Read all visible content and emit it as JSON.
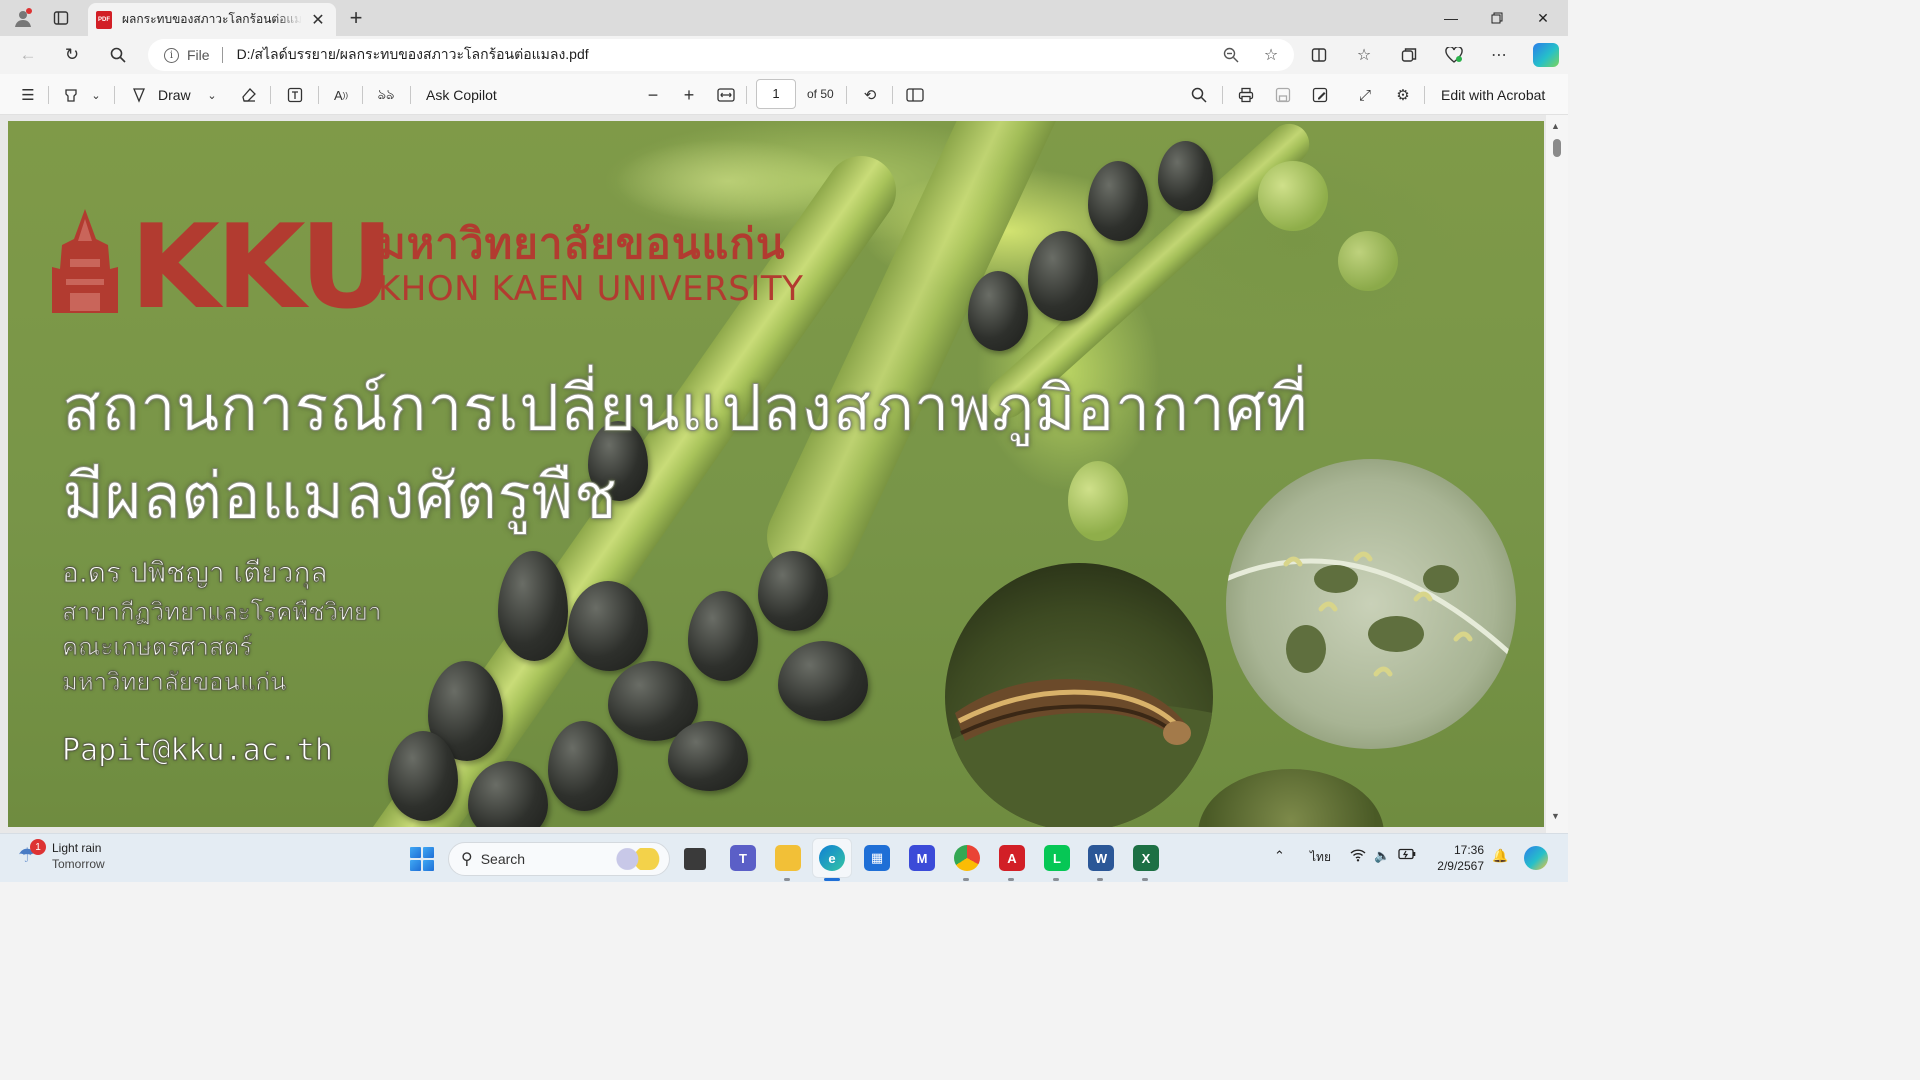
{
  "browser": {
    "tab": {
      "title": "ผลกระทบของสภาวะโลกร้อนต่อแมลง.pdf"
    },
    "address": {
      "scheme_label": "File",
      "url": "D:/สไลด์บรรยาย/ผลกระทบของสภาวะโลกร้อนต่อแมลง.pdf"
    }
  },
  "pdf_toolbar": {
    "draw_label": "Draw",
    "ask_copilot_label": "Ask Copilot",
    "page_number": "1",
    "page_total": "of 50",
    "edit_acrobat_label": "Edit with Acrobat"
  },
  "slide": {
    "logo_mark": "KKU",
    "logo_thai": "มหาวิทยาลัยขอนแก่น",
    "logo_english": "KHON KAEN UNIVERSITY",
    "title_line1": "สถานการณ์การเปลี่ยนแปลงสภาพภูมิอากาศที่",
    "title_line2": "มีผลต่อแมลงศัตรูพืช",
    "author_name": "อ.ดร ปพิชญา เตียวกุล",
    "author_dept": "สาขากีฏวิทยาและโรคพืชวิทยา",
    "author_faculty": "คณะเกษตรศาสตร์",
    "author_university": "มหาวิทยาลัยขอนแก่น",
    "email": "Papit@kku.ac.th"
  },
  "taskbar": {
    "weather_badge": "1",
    "weather_title": "Light rain",
    "weather_sub": "Tomorrow",
    "search_label": "Search",
    "language": "ไทย",
    "time": "17:36",
    "date": "2/9/2567"
  },
  "colors": {
    "kku_red": "#b23b30",
    "slide_green": "#7f9a48",
    "pdf_red": "#d21f26",
    "accent_blue": "#1f6fd6"
  }
}
